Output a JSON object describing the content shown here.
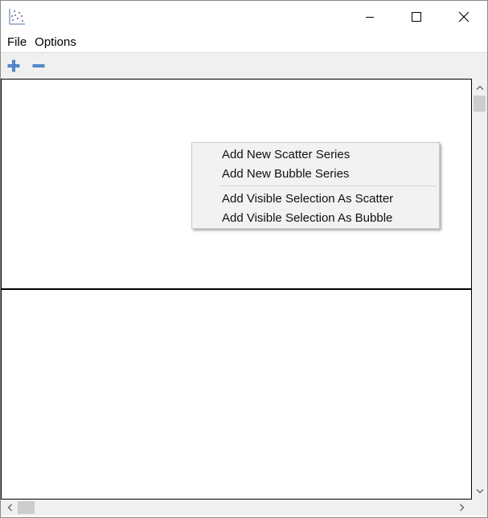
{
  "window": {
    "title": "",
    "app_icon": "scatter-plot-icon",
    "controls": {
      "minimize": "minimize-icon",
      "maximize": "maximize-icon",
      "close": "close-icon"
    }
  },
  "menubar": {
    "items": [
      {
        "label": "File"
      },
      {
        "label": "Options"
      }
    ]
  },
  "toolbar": {
    "add_icon": "plus-icon",
    "remove_icon": "minus-icon",
    "icon_color": "#2f6fb8"
  },
  "context_menu": {
    "items": [
      {
        "label": "Add New Scatter Series"
      },
      {
        "label": "Add New Bubble Series"
      },
      {
        "label": "Add Visible Selection As Scatter"
      },
      {
        "label": "Add Visible Selection As Bubble"
      }
    ]
  },
  "colors": {
    "toolbar_bg": "#f0f0f0",
    "menu_bg": "#f2f2f2",
    "scroll_thumb": "#cdcdcd"
  }
}
